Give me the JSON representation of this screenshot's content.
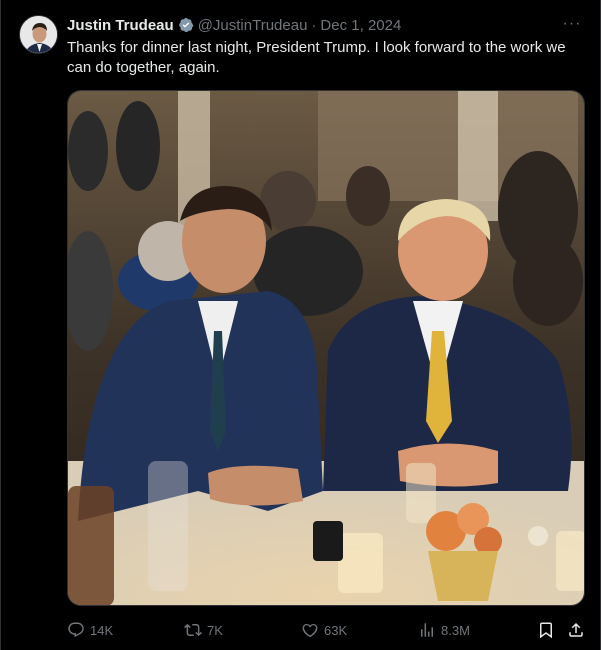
{
  "tweet": {
    "author_name": "Justin Trudeau",
    "handle": "@JustinTrudeau",
    "separator": "·",
    "date": "Dec 1, 2024",
    "text": "Thanks for dinner last night, President Trump. I look forward to the work we can do together, again.",
    "more_label": "···"
  },
  "actions": {
    "replies": "14K",
    "reposts": "7K",
    "likes": "63K",
    "views": "8.3M"
  },
  "icons": {
    "verified": "verified-badge-icon",
    "more": "more-icon",
    "reply": "reply-icon",
    "repost": "repost-icon",
    "like": "heart-icon",
    "views": "views-icon",
    "bookmark": "bookmark-icon",
    "share": "share-icon"
  },
  "colors": {
    "background": "#000000",
    "text": "#e7e9ea",
    "secondary": "#71767b",
    "verified": "#829aab"
  }
}
